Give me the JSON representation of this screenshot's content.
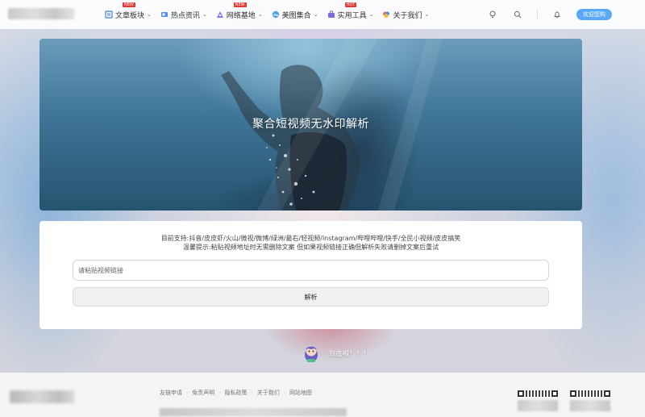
{
  "nav": [
    {
      "label": "文章板块",
      "icon": "article-icon",
      "badge": "NEW"
    },
    {
      "label": "热点资讯",
      "icon": "news-icon",
      "badge": ""
    },
    {
      "label": "网络基地",
      "icon": "network-icon",
      "badge": "NEW"
    },
    {
      "label": "美图集合",
      "icon": "gallery-icon",
      "badge": ""
    },
    {
      "label": "实用工具",
      "icon": "tools-icon",
      "badge": "HOT"
    },
    {
      "label": "关于我们",
      "icon": "about-icon",
      "badge": ""
    }
  ],
  "header": {
    "login_label": "欢迎您购"
  },
  "banner": {
    "title": "聚合短视频无水印解析"
  },
  "form": {
    "support_text": "目前支持:抖音/皮皮虾/火山/微视/微博/绿洲/最右/轻视频/instagram/哔哩哔哩/快手/全民小视频/皮皮搞笑",
    "tip_text": "温馨提示:粘贴视频地址时无需删除文案 但如果视频链接正确但解析失败请删掉文案后重试",
    "input_placeholder": "请粘贴视频链接",
    "submit_label": "解析"
  },
  "end_message": "到底啦！！！",
  "footer": {
    "links": [
      "友链申请",
      "免责声明",
      "隐私政策",
      "关于我们",
      "网站地图"
    ]
  },
  "colors": {
    "accent": "#5aa9f8",
    "badge": "#e53935",
    "footer_bg": "#f4f4f4"
  }
}
